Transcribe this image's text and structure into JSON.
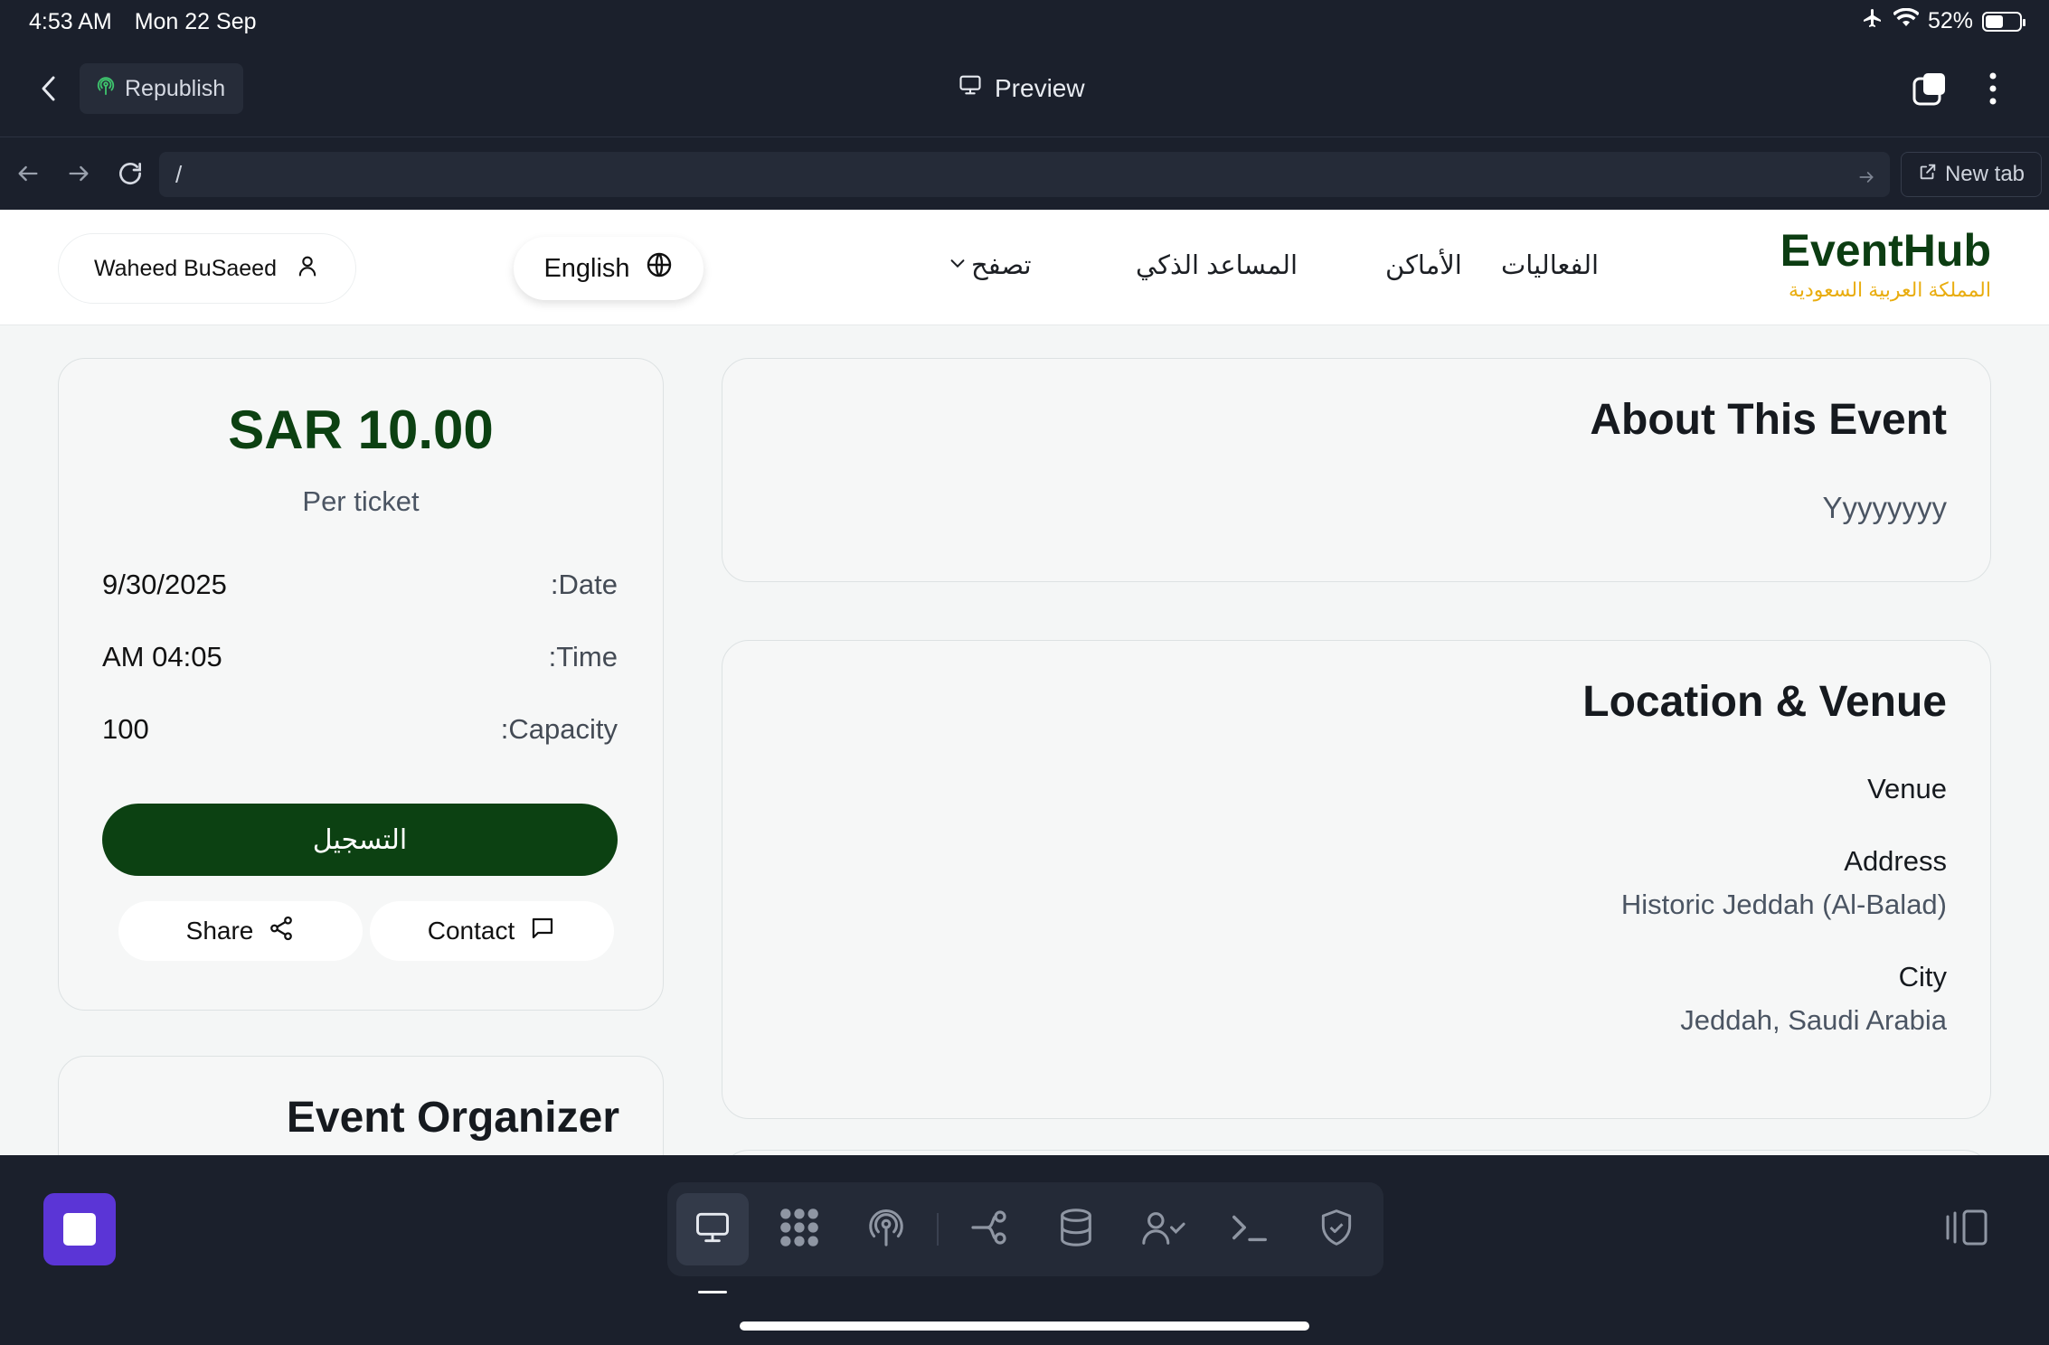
{
  "status_bar": {
    "time": "4:53 AM",
    "date": "Mon 22 Sep",
    "battery": "52%"
  },
  "toolbar": {
    "republish_label": "Republish",
    "preview_label": "Preview"
  },
  "url_bar": {
    "value": "/",
    "new_tab_label": "New tab"
  },
  "site_nav": {
    "user_name": "Waheed BuSaeed",
    "language": "English",
    "links": [
      "تصفح",
      "المساعد الذكي",
      "الأماكن",
      "الفعاليات"
    ],
    "brand_name": "EventHub",
    "brand_sub": "المملكة العربية السعودية"
  },
  "ticket": {
    "price": "SAR 10.00",
    "per_ticket": "Per ticket",
    "date_label": ":Date",
    "date_value": "9/30/2025",
    "time_label": ":Time",
    "time_value": "AM 04:05",
    "capacity_label": ":Capacity",
    "capacity_value": "100",
    "register_label": "التسجيل",
    "share_label": "Share",
    "contact_label": "Contact"
  },
  "organizer": {
    "title": "Event Organizer"
  },
  "about": {
    "title": "About This Event",
    "body": "Yyyyyyyy"
  },
  "location": {
    "title": "Location & Venue",
    "venue_label": "Venue",
    "address_label": "Address",
    "address_value": "Historic Jeddah (Al-Balad)",
    "city_label": "City",
    "city_value": "Jeddah, Saudi Arabia"
  },
  "colors": {
    "brand_green": "#0c4112",
    "brand_gold": "#e9ad0f",
    "accent_purple": "#5b35d6",
    "chrome": "#1b202c"
  }
}
